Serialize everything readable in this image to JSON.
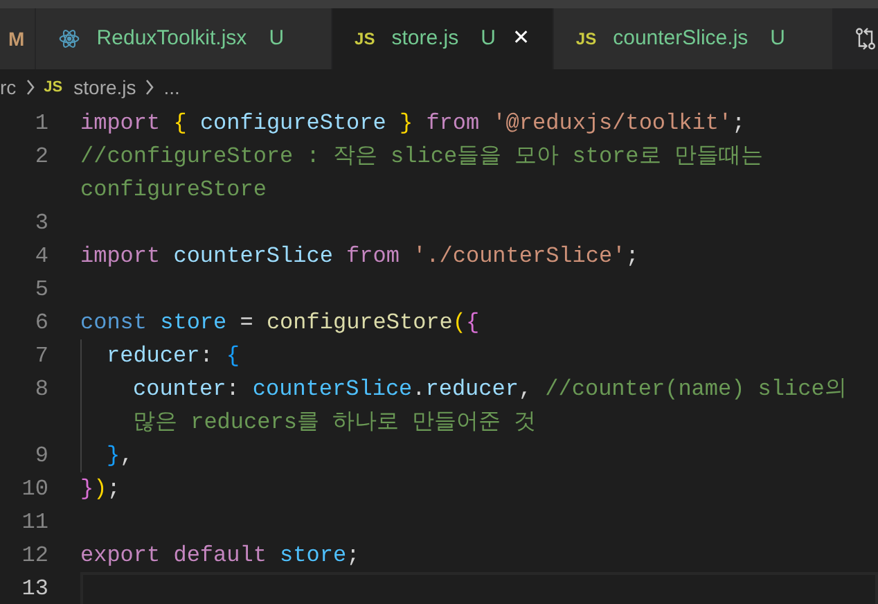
{
  "tabs": [
    {
      "kind": "partial",
      "status": "M",
      "selected": false
    },
    {
      "kind": "react",
      "label": "ReduxToolkit.jsx",
      "status": "U",
      "selected": false
    },
    {
      "kind": "js",
      "icon_text": "JS",
      "label": "store.js",
      "status": "U",
      "selected": true,
      "close": "✕"
    },
    {
      "kind": "js",
      "icon_text": "JS",
      "label": "counterSlice.js",
      "status": "U",
      "selected": false
    }
  ],
  "breadcrumb": {
    "items": [
      {
        "kind": "text",
        "text": "rc"
      },
      {
        "kind": "file",
        "icon_text": "JS",
        "text": "store.js"
      },
      {
        "kind": "text",
        "text": "..."
      }
    ]
  },
  "editor": {
    "lines": [
      {
        "number": "1",
        "current": false,
        "rows": [
          [
            {
              "kind": "keyword",
              "text": "import"
            },
            {
              "kind": "plain",
              "text": " "
            },
            {
              "kind": "brace1",
              "text": "{"
            },
            {
              "kind": "plain",
              "text": " "
            },
            {
              "kind": "variable",
              "text": "configureStore"
            },
            {
              "kind": "plain",
              "text": " "
            },
            {
              "kind": "brace1",
              "text": "}"
            },
            {
              "kind": "plain",
              "text": " "
            },
            {
              "kind": "keyword",
              "text": "from"
            },
            {
              "kind": "plain",
              "text": " "
            },
            {
              "kind": "string",
              "text": "'@reduxjs/toolkit'"
            },
            {
              "kind": "plain",
              "text": ";"
            }
          ]
        ]
      },
      {
        "number": "2",
        "current": false,
        "rows": [
          [
            {
              "kind": "comment",
              "text": "//configureStore : 작은 slice들을 모아 store로 만들때는"
            }
          ],
          [
            {
              "kind": "comment",
              "text": "configureStore"
            }
          ]
        ]
      },
      {
        "number": "3",
        "current": false,
        "rows": [
          []
        ]
      },
      {
        "number": "4",
        "current": false,
        "rows": [
          [
            {
              "kind": "keyword",
              "text": "import"
            },
            {
              "kind": "plain",
              "text": " "
            },
            {
              "kind": "variable",
              "text": "counterSlice"
            },
            {
              "kind": "plain",
              "text": " "
            },
            {
              "kind": "keyword",
              "text": "from"
            },
            {
              "kind": "plain",
              "text": " "
            },
            {
              "kind": "string",
              "text": "'./counterSlice'"
            },
            {
              "kind": "plain",
              "text": ";"
            }
          ]
        ]
      },
      {
        "number": "5",
        "current": false,
        "rows": [
          []
        ]
      },
      {
        "number": "6",
        "current": false,
        "rows": [
          [
            {
              "kind": "storage",
              "text": "const"
            },
            {
              "kind": "plain",
              "text": " "
            },
            {
              "kind": "constant",
              "text": "store"
            },
            {
              "kind": "plain",
              "text": " = "
            },
            {
              "kind": "function",
              "text": "configureStore"
            },
            {
              "kind": "brace1",
              "text": "("
            },
            {
              "kind": "brace2",
              "text": "{"
            }
          ]
        ],
        "children": [
          {
            "number": "7",
            "current": false,
            "rows": [
              [
                {
                  "kind": "property",
                  "text": "reducer"
                },
                {
                  "kind": "plain",
                  "text": ": "
                },
                {
                  "kind": "brace3",
                  "text": "{"
                }
              ]
            ],
            "children": [
              {
                "number": "8",
                "current": false,
                "rows": [
                  [
                    {
                      "kind": "property",
                      "text": "counter"
                    },
                    {
                      "kind": "plain",
                      "text": ": "
                    },
                    {
                      "kind": "constant",
                      "text": "counterSlice"
                    },
                    {
                      "kind": "plain",
                      "text": "."
                    },
                    {
                      "kind": "property",
                      "text": "reducer"
                    },
                    {
                      "kind": "plain",
                      "text": ", "
                    },
                    {
                      "kind": "comment",
                      "text": "//counter(name) slice의"
                    }
                  ],
                  [
                    {
                      "kind": "comment",
                      "text": "많은 reducers를 하나로 만들어준 것"
                    }
                  ]
                ]
              }
            ]
          },
          {
            "number": "9",
            "current": false,
            "rows": [
              [
                {
                  "kind": "brace3",
                  "text": "}"
                },
                {
                  "kind": "plain",
                  "text": ","
                }
              ]
            ]
          }
        ]
      },
      {
        "number": "10",
        "current": false,
        "rows": [
          [
            {
              "kind": "brace2",
              "text": "}"
            },
            {
              "kind": "brace1",
              "text": ")"
            },
            {
              "kind": "plain",
              "text": ";"
            }
          ]
        ]
      },
      {
        "number": "11",
        "current": false,
        "rows": [
          []
        ]
      },
      {
        "number": "12",
        "current": false,
        "rows": [
          [
            {
              "kind": "keyword",
              "text": "export"
            },
            {
              "kind": "plain",
              "text": " "
            },
            {
              "kind": "keyword",
              "text": "default"
            },
            {
              "kind": "plain",
              "text": " "
            },
            {
              "kind": "constant",
              "text": "store"
            },
            {
              "kind": "plain",
              "text": ";"
            }
          ]
        ]
      },
      {
        "number": "13",
        "current": true,
        "rows": [
          []
        ]
      }
    ]
  }
}
